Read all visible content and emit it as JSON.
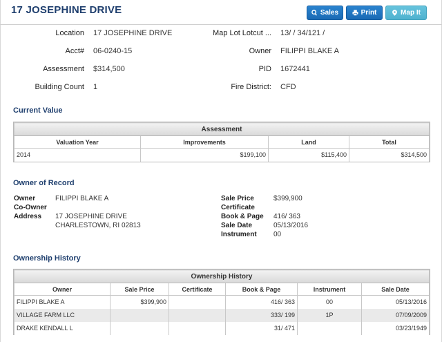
{
  "header": {
    "title": "17 JOSEPHINE DRIVE",
    "buttons": {
      "sales": "Sales",
      "print": "Print",
      "map": "Map It"
    }
  },
  "summary": {
    "location_label": "Location",
    "location_value": "17 JOSEPHINE DRIVE",
    "acct_label": "Acct#",
    "acct_value": "06-0240-15",
    "assessment_label": "Assessment",
    "assessment_value": "$314,500",
    "building_count_label": "Building Count",
    "building_count_value": "1",
    "maplot_label": "Map Lot Lotcut ...",
    "maplot_value": "13/ / 34/121 /",
    "owner_label": "Owner",
    "owner_value": "FILIPPI BLAKE A",
    "pid_label": "PID",
    "pid_value": "1672441",
    "fire_label": "Fire District:",
    "fire_value": "CFD"
  },
  "current_value": {
    "section_title": "Current Value",
    "caption": "Assessment",
    "columns": [
      "Valuation Year",
      "Improvements",
      "Land",
      "Total"
    ],
    "rows": [
      [
        "2014",
        "$199,100",
        "$115,400",
        "$314,500"
      ]
    ]
  },
  "owner_of_record": {
    "section_title": "Owner of Record",
    "owner_label": "Owner",
    "owner_value": "FILIPPI BLAKE A",
    "coowner_label": "Co-Owner",
    "coowner_value": "",
    "address_label": "Address",
    "address_line1": "17 JOSEPHINE DRIVE",
    "address_line2": "CHARLESTOWN, RI 02813",
    "sale_price_label": "Sale Price",
    "sale_price_value": "$399,900",
    "certificate_label": "Certificate",
    "certificate_value": "",
    "book_page_label": "Book & Page",
    "book_page_value": "416/ 363",
    "sale_date_label": "Sale Date",
    "sale_date_value": "05/13/2016",
    "instrument_label": "Instrument",
    "instrument_value": "00"
  },
  "ownership_history": {
    "section_title": "Ownership History",
    "caption": "Ownership History",
    "columns": [
      "Owner",
      "Sale Price",
      "Certificate",
      "Book & Page",
      "Instrument",
      "Sale Date"
    ],
    "rows": [
      [
        "FILIPPI BLAKE A",
        "$399,900",
        "",
        "416/ 363",
        "00",
        "05/13/2016"
      ],
      [
        "VILLAGE FARM LLC",
        "",
        "",
        "333/ 199",
        "1P",
        "07/09/2009"
      ],
      [
        "DRAKE KENDALL L",
        "",
        "",
        "31/ 471",
        "",
        "03/23/1949"
      ]
    ]
  }
}
